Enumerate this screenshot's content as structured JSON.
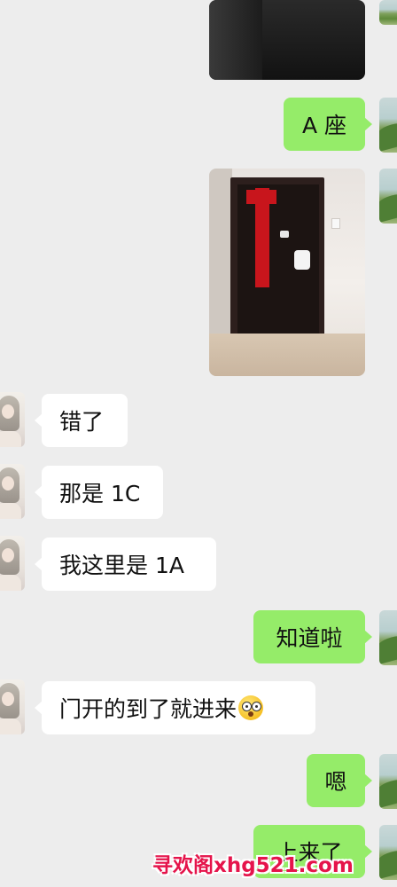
{
  "conversation": {
    "messages": [
      {
        "side": "right",
        "type": "image",
        "label": "photo-dark"
      },
      {
        "side": "right",
        "type": "text",
        "text": "A 座"
      },
      {
        "side": "right",
        "type": "image",
        "label": "photo-door"
      },
      {
        "side": "left",
        "type": "text",
        "text": "错了"
      },
      {
        "side": "left",
        "type": "text",
        "text": "那是 1C"
      },
      {
        "side": "left",
        "type": "text",
        "text": "我这里是 1A"
      },
      {
        "side": "right",
        "type": "text",
        "text": "知道啦"
      },
      {
        "side": "left",
        "type": "text",
        "text": "门开的到了就进来",
        "emoji": "flushed-face-icon"
      },
      {
        "side": "right",
        "type": "text",
        "text": "嗯"
      },
      {
        "side": "right",
        "type": "text",
        "text": "上来了"
      }
    ]
  },
  "watermark": {
    "text": "寻欢阁xhg521.com"
  },
  "colors": {
    "background": "#ededed",
    "outgoing_bubble": "#95ec69",
    "incoming_bubble": "#ffffff",
    "watermark": "#e5144b"
  }
}
